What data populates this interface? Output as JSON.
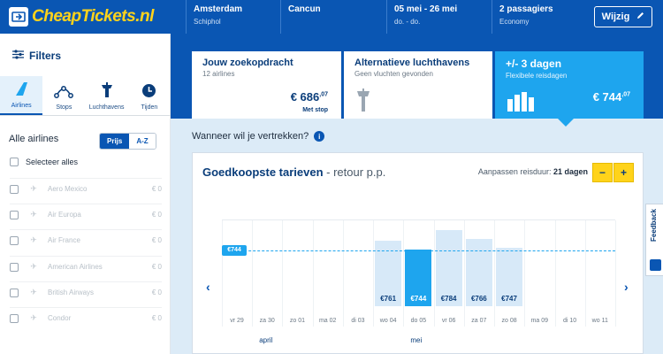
{
  "header": {
    "logo_text": "CheapTickets.nl",
    "segments": [
      {
        "title": "Amsterdam",
        "sub": "Schiphol"
      },
      {
        "title": "Cancun",
        "sub": ""
      },
      {
        "title": "05 mei - 26 mei",
        "sub": "do. - do."
      },
      {
        "title": "2 passagiers",
        "sub": "Economy"
      }
    ],
    "edit_label": "Wijzig"
  },
  "sidebar": {
    "title": "Filters",
    "tabs": [
      {
        "label": "Airlines",
        "icon": "plane-tail-icon"
      },
      {
        "label": "Stops",
        "icon": "stops-icon"
      },
      {
        "label": "Luchthavens",
        "icon": "tower-icon"
      },
      {
        "label": "Tijden",
        "icon": "clock-icon"
      }
    ],
    "airlines_heading": "Alle airlines",
    "sort_options": [
      "Prijs",
      "A-Z"
    ],
    "select_all": "Selecteer alles",
    "airlines": [
      {
        "name": "Aero Mexico",
        "price": "€ 0"
      },
      {
        "name": "Air Europa",
        "price": "€ 0"
      },
      {
        "name": "Air France",
        "price": "€ 0"
      },
      {
        "name": "American Airlines",
        "price": "€ 0"
      },
      {
        "name": "British Airways",
        "price": "€ 0"
      },
      {
        "name": "Condor",
        "price": "€ 0"
      }
    ]
  },
  "cards": [
    {
      "title": "Jouw zoekopdracht",
      "sub": "12 airlines",
      "price": "€ 686",
      "cents": ",07",
      "note": "Met stop"
    },
    {
      "title": "Alternatieve luchthavens",
      "sub": "Geen vluchten gevonden",
      "price": "",
      "cents": "",
      "note": ""
    },
    {
      "title": "+/- 3 dagen",
      "sub": "Flexibele reisdagen",
      "price": "€ 744",
      "cents": ",07",
      "note": ""
    }
  ],
  "question": "Wanneer wil je vertrekken?",
  "panel": {
    "title": "Goedkoopste tarieven",
    "title_suffix": " - retour p.p.",
    "adjust_label": "Aanpassen reisduur:",
    "adjust_value": "21 dagen",
    "minus": "−",
    "plus": "+"
  },
  "chart_data": {
    "type": "bar",
    "title": "Goedkoopste tarieven",
    "reference_label": "€744",
    "reference_value": 744,
    "categories": [
      "vr 29",
      "za 30",
      "zo 01",
      "ma 02",
      "di 03",
      "wo 04",
      "do 05",
      "vr 06",
      "za 07",
      "zo 08",
      "ma 09",
      "di 10",
      "wo 11"
    ],
    "values": [
      null,
      null,
      null,
      null,
      null,
      761,
      744,
      784,
      766,
      747,
      null,
      null,
      null
    ],
    "value_labels": [
      "",
      "",
      "",
      "",
      "",
      "€761",
      "€744",
      "€784",
      "€766",
      "€747",
      "",
      "",
      ""
    ],
    "selected_index": 6,
    "months": [
      {
        "label": "april",
        "at_index": 1
      },
      {
        "label": "mei",
        "at_index": 6
      }
    ],
    "ylim": [
      0,
      800
    ]
  },
  "feedback_label": "Feedback"
}
